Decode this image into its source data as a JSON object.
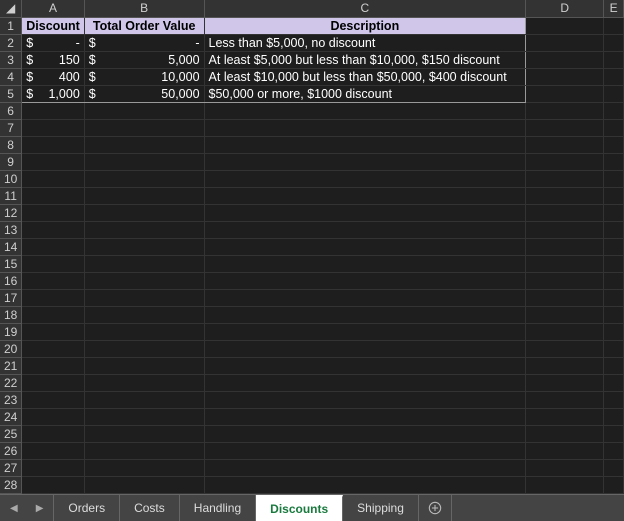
{
  "columns": [
    "A",
    "B",
    "C",
    "D",
    "E"
  ],
  "row_numbers": [
    1,
    2,
    3,
    4,
    5,
    6,
    7,
    8,
    9,
    10,
    11,
    12,
    13,
    14,
    15,
    16,
    17,
    18,
    19,
    20,
    21,
    22,
    23,
    24,
    25,
    26,
    27,
    28
  ],
  "header_row": {
    "A": "Discount",
    "B": "Total Order Value",
    "C": "Description"
  },
  "data_rows": [
    {
      "discount_sym": "$",
      "discount_val": "-",
      "total_sym": "$",
      "total_val": "-",
      "desc": "Less than $5,000, no discount"
    },
    {
      "discount_sym": "$",
      "discount_val": "150",
      "total_sym": "$",
      "total_val": "5,000",
      "desc": "At least $5,000 but less than $10,000, $150 discount"
    },
    {
      "discount_sym": "$",
      "discount_val": "400",
      "total_sym": "$",
      "total_val": "10,000",
      "desc": "At least $10,000 but less than $50,000, $400 discount"
    },
    {
      "discount_sym": "$",
      "discount_val": "1,000",
      "total_sym": "$",
      "total_val": "50,000",
      "desc": "$50,000 or more, $1000 discount"
    }
  ],
  "tabs": [
    {
      "label": "Orders",
      "active": false
    },
    {
      "label": "Costs",
      "active": false
    },
    {
      "label": "Handling",
      "active": false
    },
    {
      "label": "Discounts",
      "active": true
    },
    {
      "label": "Shipping",
      "active": false
    }
  ],
  "chart_data": {
    "type": "table",
    "title": "Discounts",
    "columns": [
      "Discount",
      "Total Order Value",
      "Description"
    ],
    "rows": [
      [
        0,
        0,
        "Less than $5,000, no discount"
      ],
      [
        150,
        5000,
        "At least $5,000 but less than $10,000, $150 discount"
      ],
      [
        400,
        10000,
        "At least $10,000 but less than $50,000, $400 discount"
      ],
      [
        1000,
        50000,
        "$50,000 or more, $1000 discount"
      ]
    ]
  }
}
